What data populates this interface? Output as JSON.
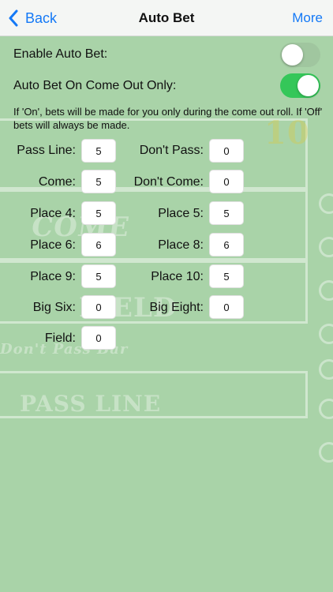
{
  "nav": {
    "back_label": "Back",
    "title": "Auto Bet",
    "more_label": "More"
  },
  "settings": {
    "enable_auto_bet": {
      "label": "Enable Auto Bet:",
      "on": false
    },
    "come_out_only": {
      "label": "Auto Bet On Come Out Only:",
      "on": true
    },
    "note": "If 'On', bets will be made for you only during the come out roll. If 'Off' bets will always be made."
  },
  "bets": [
    {
      "label": "Pass Line:",
      "value": "5"
    },
    {
      "label": "Don't Pass:",
      "value": "0"
    },
    {
      "label": "Come:",
      "value": "5"
    },
    {
      "label": "Don't Come:",
      "value": "0"
    },
    {
      "label": "Place 4:",
      "value": "5"
    },
    {
      "label": "Place 5:",
      "value": "5"
    },
    {
      "label": "Place 6:",
      "value": "6"
    },
    {
      "label": "Place 8:",
      "value": "6"
    },
    {
      "label": "Place 9:",
      "value": "5"
    },
    {
      "label": "Place 10:",
      "value": "5"
    },
    {
      "label": "Big Six:",
      "value": "0"
    },
    {
      "label": "Big Eight:",
      "value": "0"
    },
    {
      "label": "Field:",
      "value": "0"
    }
  ],
  "colors": {
    "accent": "#1479f6",
    "switch_on": "#34c759",
    "table_felt": "#a9d3a8"
  }
}
